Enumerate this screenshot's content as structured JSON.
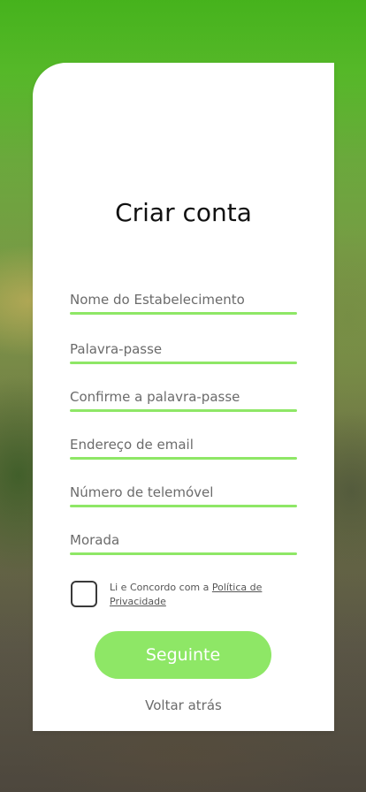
{
  "title": "Criar conta",
  "fields": [
    {
      "label": "Nome do Estabelecimento"
    },
    {
      "label": "Palavra-passe"
    },
    {
      "label": "Confirme a palavra-passe"
    },
    {
      "label": "Endereço de email"
    },
    {
      "label": "Número de telemóvel"
    },
    {
      "label": "Morada"
    }
  ],
  "terms": {
    "prefix": "Li e Concordo com a ",
    "link": "Política de Privacidade"
  },
  "next_button": "Seguinte",
  "back_link": "Voltar atrás",
  "colors": {
    "accent": "#8ee766",
    "card": "#ffffff"
  }
}
